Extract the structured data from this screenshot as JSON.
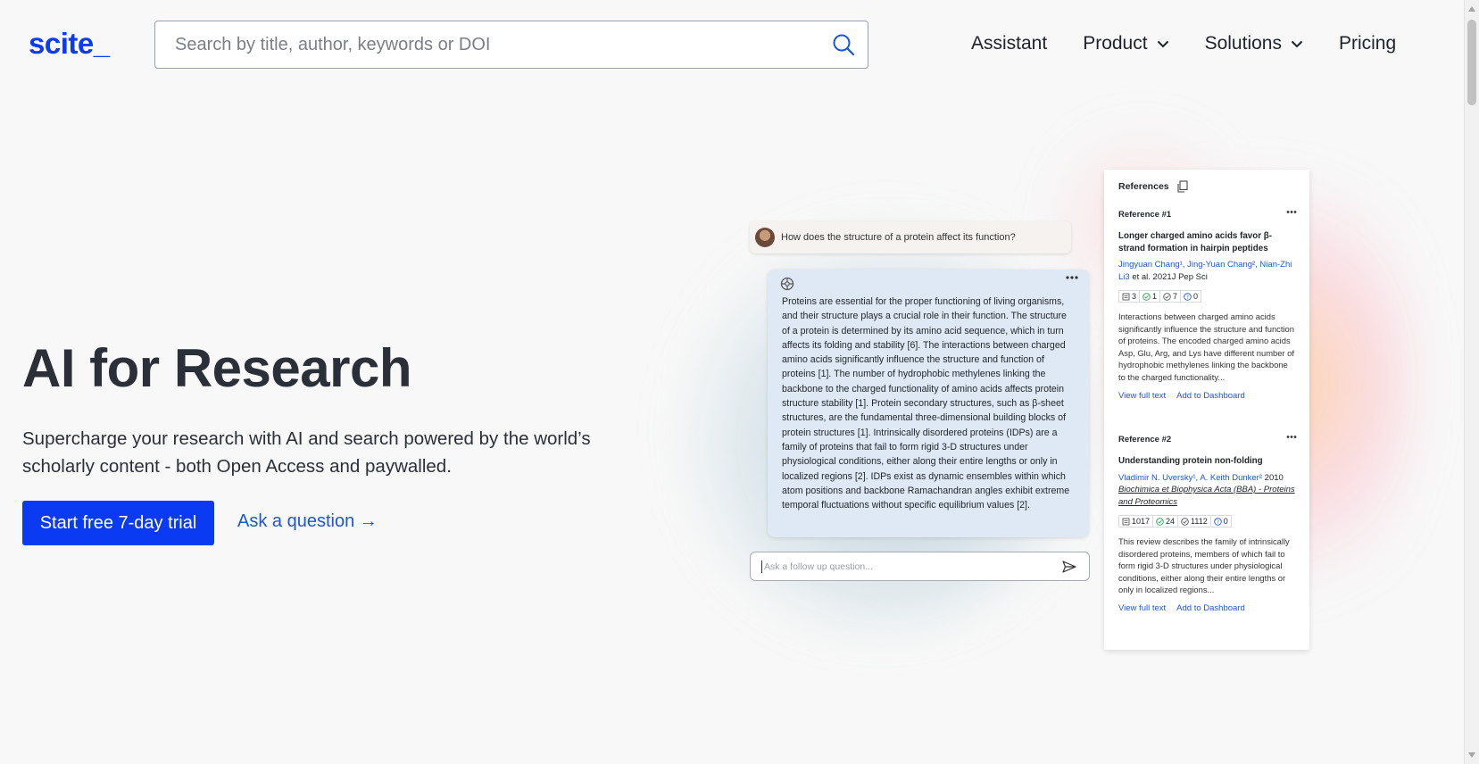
{
  "header": {
    "logo": "scite_",
    "search_placeholder": "Search by title, author, keywords or DOI",
    "nav": [
      {
        "label": "Assistant",
        "dropdown": false
      },
      {
        "label": "Product",
        "dropdown": true
      },
      {
        "label": "Solutions",
        "dropdown": true
      },
      {
        "label": "Pricing",
        "dropdown": false
      }
    ]
  },
  "hero": {
    "title": "AI for Research",
    "subtitle": "Supercharge your research with AI and search powered by the world’s scholarly content - both Open Access and paywalled.",
    "cta_label": "Start free 7-day trial",
    "ask_label": "Ask a question →"
  },
  "chat": {
    "question": "How does the structure of a protein affect its function?",
    "answer": "Proteins are essential for the proper functioning of living organisms, and their structure plays a crucial role in their function. The structure of a protein is determined by its amino acid sequence, which in turn affects its folding and stability [6]. The interactions between charged amino acids significantly influence the structure and function of proteins [1]. The number of hydrophobic methylenes linking the backbone to the charged functionality of amino acids affects protein structure stability [1]. Protein secondary structures, such as β-sheet structures, are the fundamental three-dimensional building blocks of protein structures [1]. Intrinsically disordered proteins (IDPs) are a family of proteins that fail to form rigid 3-D structures under physiological conditions, either along their entire lengths or only in localized regions [2]. IDPs exist as dynamic ensembles within which atom positions and backbone Ramachandran angles exhibit extreme temporal fluctuations without specific equilibrium values [2].",
    "followup_placeholder": "Ask a follow up question..."
  },
  "references": {
    "title": "References",
    "items": [
      {
        "label": "Reference #1",
        "title": "Longer charged amino acids favor β-strand formation in hairpin peptides",
        "authors": "Jingyuan Chang¹, Jing-Yuan Chang², Nian-Zhi Li3",
        "meta": " et al. 2021J Pep Sci",
        "journal": "",
        "counts": {
          "publications": "3",
          "supporting": "1",
          "mentioning": "7",
          "contrasting": "0"
        },
        "abstract": "Interactions between charged amino acids significantly influence the structure and function of proteins. The encoded charged amino acids Asp, Glu, Arg, and Lys have different number of hydrophobic methylenes linking the backbone to the charged functionality...",
        "view_label": "View full text",
        "dashboard_label": "Add to Dashboard"
      },
      {
        "label": "Reference #2",
        "title": "Understanding protein non-folding",
        "authors": "Vladimir N. Uversky¹, A. Keith Dunker²",
        "meta": " 2010",
        "journal": "Biochimica et Biophysica Acta (BBA) - Proteins and Proteomics",
        "counts": {
          "publications": "1017",
          "supporting": "24",
          "mentioning": "1112",
          "contrasting": "0"
        },
        "abstract": "This review describes the family of intrinsically disordered proteins, members of which fail to form rigid 3-D structures under physiological conditions, either along their entire lengths or only in localized regions...",
        "view_label": "View full text",
        "dashboard_label": "Add to Dashboard"
      }
    ]
  },
  "colors": {
    "brand": "#0a3bf2",
    "link": "#1a56db",
    "supporting": "#2e9d4b",
    "contrasting": "#1a56db"
  }
}
